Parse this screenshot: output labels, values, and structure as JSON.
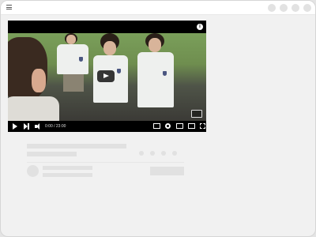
{
  "header": {
    "menu_icon": "menu-icon"
  },
  "player": {
    "time": "0:00 / 23:00",
    "icons": [
      "info-icon",
      "play-icon",
      "next-icon",
      "volume-icon",
      "captions-icon",
      "settings-icon",
      "miniplayer-icon",
      "theater-icon",
      "fullscreen-icon"
    ],
    "info_glyph": "i"
  }
}
